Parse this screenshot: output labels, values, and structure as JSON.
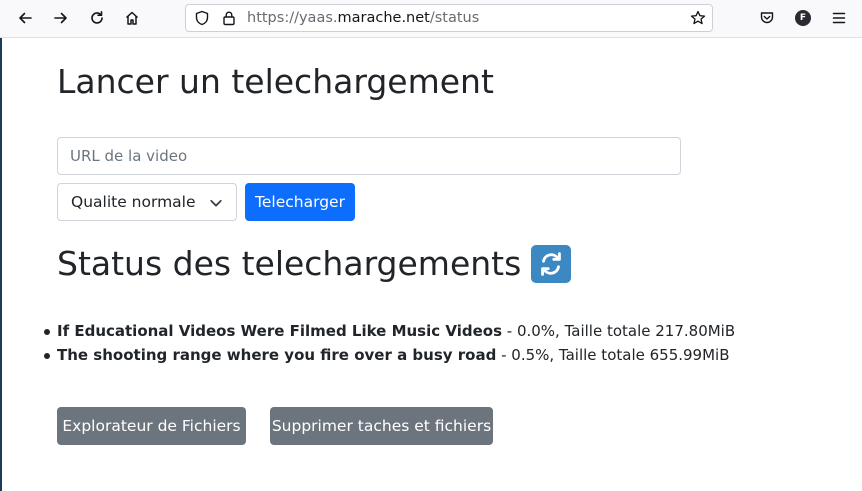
{
  "browser": {
    "url_prefix": "https://yaas.",
    "url_host": "marache.net",
    "url_path": "/status",
    "profile_initial": "F",
    "icons": {
      "back": "back-arrow-icon",
      "forward": "forward-arrow-icon",
      "reload": "reload-icon",
      "home": "home-icon",
      "tracking": "shield-icon",
      "secure": "lock-icon",
      "bookmark": "star-icon",
      "pocket": "pocket-icon",
      "menu": "hamburger-menu-icon"
    }
  },
  "page": {
    "title": "Lancer un telechargement",
    "url_input": {
      "placeholder": "URL de la video",
      "value": ""
    },
    "quality_select": {
      "selected": "Qualite normale"
    },
    "download_button": "Telecharger",
    "status_title": "Status des telechargements",
    "status_icon": "refresh-arrows-icon",
    "downloads": [
      {
        "title": "If Educational Videos Were Filmed Like Music Videos",
        "details": " - 0.0%, Taille totale 217.80MiB"
      },
      {
        "title": "The shooting range where you fire over a busy road",
        "details": " - 0.5%, Taille totale 655.99MiB"
      }
    ],
    "explorer_button": "Explorateur de Fichiers",
    "delete_button": "Supprimer taches et fichiers"
  },
  "colors": {
    "primary": "#0d6efd",
    "secondary": "#6c757d",
    "text": "#212529",
    "refresh_badge": "#3b88c3"
  }
}
